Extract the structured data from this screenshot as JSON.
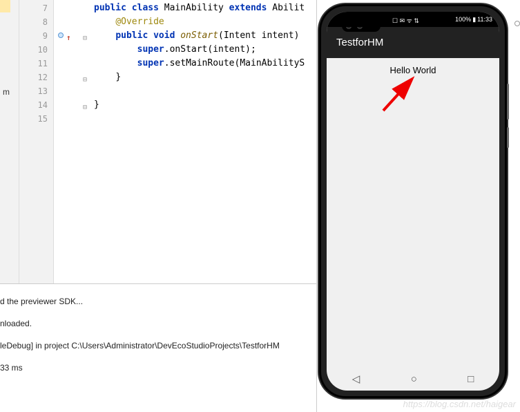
{
  "code": {
    "lines": [
      {
        "num": "7",
        "segments": [
          [
            "kw",
            "public class "
          ],
          [
            "ident",
            "MainAbility "
          ],
          [
            "kw",
            "extends "
          ],
          [
            "ident",
            "Abilit"
          ]
        ]
      },
      {
        "num": "8",
        "segments": [
          [
            "pad",
            "    "
          ],
          [
            "ann",
            "@Override"
          ]
        ]
      },
      {
        "num": "9",
        "icons": true,
        "segments": [
          [
            "pad",
            "    "
          ],
          [
            "kw",
            "public void "
          ],
          [
            "fn",
            "onStart"
          ],
          [
            "ident",
            "(Intent intent) "
          ]
        ]
      },
      {
        "num": "10",
        "segments": [
          [
            "pad",
            "        "
          ],
          [
            "kw",
            "super"
          ],
          [
            "ident",
            ".onStart(intent);"
          ]
        ]
      },
      {
        "num": "11",
        "segments": [
          [
            "pad",
            "        "
          ],
          [
            "kw",
            "super"
          ],
          [
            "ident",
            ".setMainRoute(MainAbilityS"
          ]
        ]
      },
      {
        "num": "12",
        "fold": true,
        "segments": [
          [
            "pad",
            "    "
          ],
          [
            "ident",
            "}"
          ]
        ]
      },
      {
        "num": "13",
        "segments": []
      },
      {
        "num": "14",
        "fold": true,
        "segments": [
          [
            "ident",
            "}"
          ]
        ]
      },
      {
        "num": "15",
        "segments": []
      }
    ]
  },
  "console": {
    "lines": [
      "d the previewer SDK...",
      "nloaded.",
      "leDebug] in project C:\\Users\\Administrator\\DevEcoStudioProjects\\TestforHM",
      "33 ms"
    ]
  },
  "phone": {
    "status": {
      "icons": "☐ ✉ ᯤ ⇅",
      "battery": "100%",
      "batt_icon": "▮",
      "time": "11:33"
    },
    "app_title": "TestforHM",
    "body_text": "Hello World",
    "nav": {
      "back": "◁",
      "home": "○",
      "recent": "□"
    }
  },
  "watermark": "https://blog.csdn.net/haigear"
}
